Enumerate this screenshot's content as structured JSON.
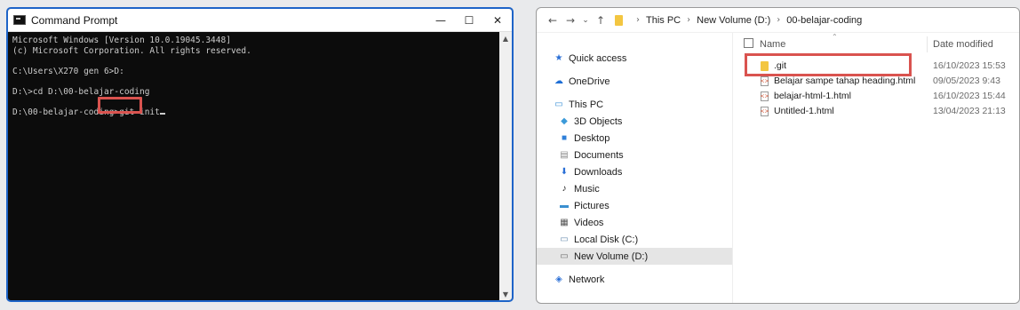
{
  "cmd": {
    "title": "Command Prompt",
    "lines": {
      "l1": "Microsoft Windows [Version 10.0.19045.3448]",
      "l2": "(c) Microsoft Corporation. All rights reserved.",
      "l3": "C:\\Users\\X270 gen 6>D:",
      "l4": "D:\\>cd D:\\00-belajar-coding",
      "l5": "D:\\00-belajar-coding>git init"
    },
    "controls": {
      "minimize": "—",
      "maximize": "☐",
      "close": "✕"
    }
  },
  "explorer": {
    "breadcrumbs": [
      "This PC",
      "New Volume (D:)",
      "00-belajar-coding"
    ],
    "nav": [
      {
        "label": "Quick access",
        "icon": "star-icon",
        "color": "#2a6fd6"
      },
      {
        "label": "OneDrive",
        "icon": "cloud-icon",
        "color": "#1f6fd6"
      },
      {
        "label": "This PC",
        "icon": "computer-icon",
        "color": "#3a8fd6"
      },
      {
        "label": "3D Objects",
        "icon": "cube-icon",
        "color": "#3b9ad9"
      },
      {
        "label": "Desktop",
        "icon": "desktop-icon",
        "color": "#2f7fd9"
      },
      {
        "label": "Documents",
        "icon": "document-icon",
        "color": "#8a8a8a"
      },
      {
        "label": "Downloads",
        "icon": "download-icon",
        "color": "#2a6fd6"
      },
      {
        "label": "Music",
        "icon": "music-icon",
        "color": "#1a1a1a"
      },
      {
        "label": "Pictures",
        "icon": "pictures-icon",
        "color": "#3b8fd0"
      },
      {
        "label": "Videos",
        "icon": "video-icon",
        "color": "#555555"
      },
      {
        "label": "Local Disk (C:)",
        "icon": "disk-icon",
        "color": "#6b8fb0"
      },
      {
        "label": "New Volume (D:)",
        "icon": "disk-icon",
        "color": "#6b6b6b"
      },
      {
        "label": "Network",
        "icon": "network-icon",
        "color": "#2a6fd6"
      }
    ],
    "columns": {
      "name": "Name",
      "date": "Date modified"
    },
    "files": [
      {
        "name": ".git",
        "date": "16/10/2023 15:53",
        "type": "folder"
      },
      {
        "name": "Belajar sampe tahap heading.html",
        "date": "09/05/2023 9:43",
        "type": "html"
      },
      {
        "name": "belajar-html-1.html",
        "date": "16/10/2023 15:44",
        "type": "html"
      },
      {
        "name": "Untitled-1.html",
        "date": "13/04/2023 21:13",
        "type": "html"
      }
    ],
    "highlight_color": "#d9534f"
  }
}
